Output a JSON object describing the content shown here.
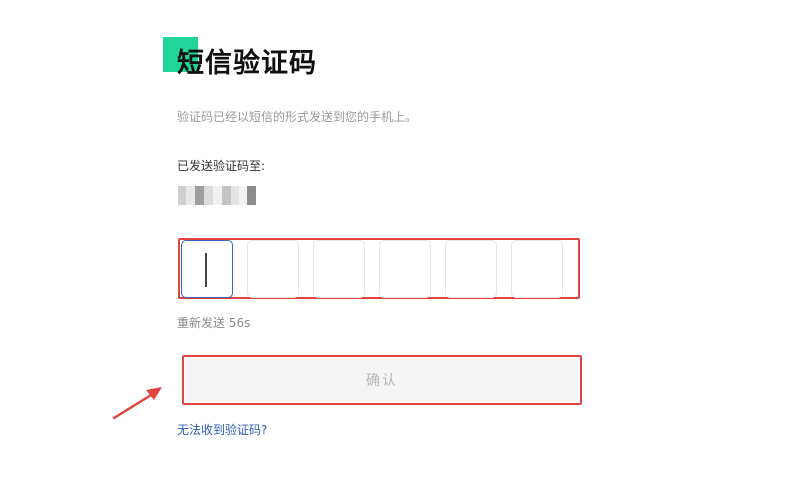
{
  "header": {
    "title": "短信验证码",
    "accent_color": "#20d49a"
  },
  "info": {
    "subtitle": "验证码已经以短信的形式发送到您的手机上。",
    "sent_to_label": "已发送验证码至:"
  },
  "phone": {
    "masked_icon": "pixelated-phone-number"
  },
  "code_input": {
    "boxes": [
      "",
      "",
      "",
      "",
      "",
      ""
    ],
    "active_index": 0,
    "highlight_color": "#e0443c",
    "focus_color": "#3a63c9"
  },
  "resend": {
    "text": "重新发送 56s"
  },
  "confirm": {
    "label": "确认"
  },
  "help": {
    "link_text": "无法收到验证码?"
  },
  "annotation": {
    "arrow_icon": "red-arrow-icon",
    "color": "#e0443c"
  }
}
